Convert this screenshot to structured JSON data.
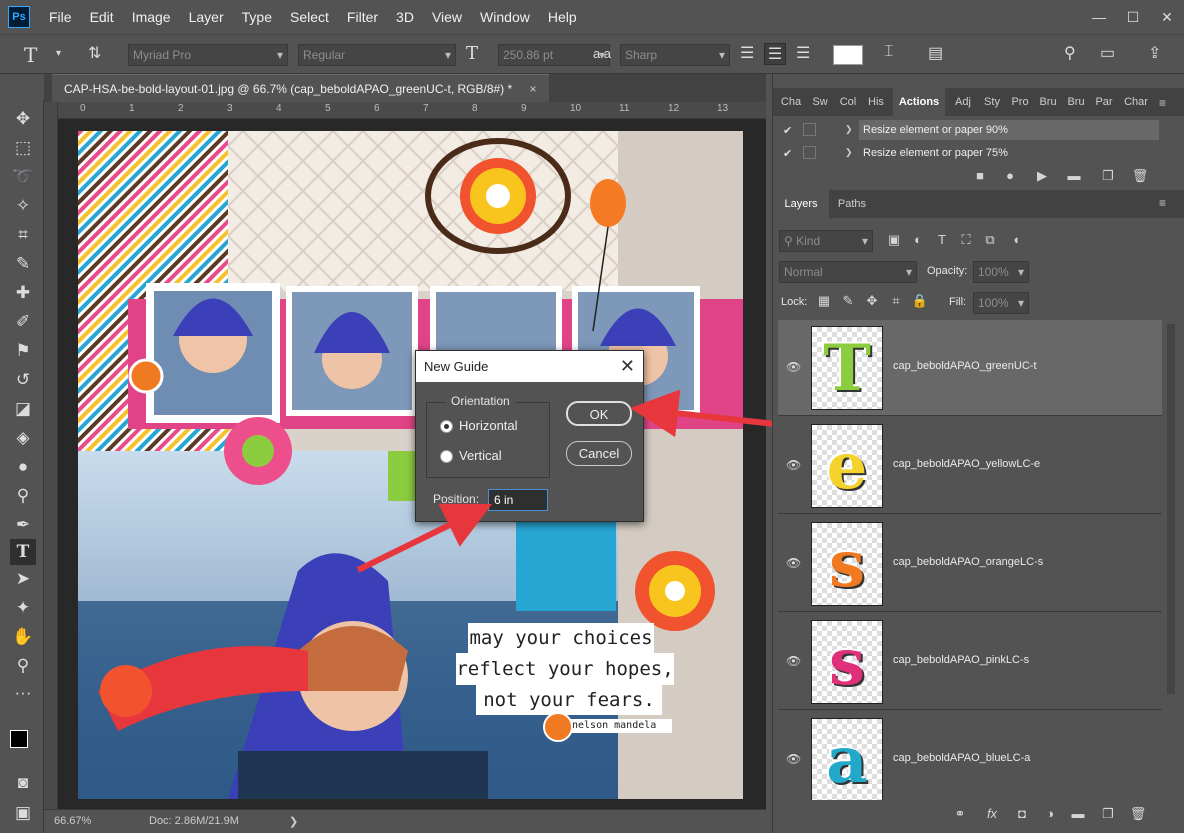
{
  "app": {
    "logo": "Ps"
  },
  "menu": [
    "File",
    "Edit",
    "Image",
    "Layer",
    "Type",
    "Select",
    "Filter",
    "3D",
    "View",
    "Window",
    "Help"
  ],
  "window_controls": {
    "minimize": "—",
    "maximize": "☐",
    "close": "✕"
  },
  "options": {
    "font_family": "Myriad Pro",
    "font_style": "Regular",
    "font_size": "250.86 pt",
    "aa_label": "a a",
    "antialias": "Sharp"
  },
  "document": {
    "tab_title": "CAP-HSA-be-bold-layout-01.jpg @ 66.7% (cap_beboldAPAO_greenUC-t, RGB/8#) *",
    "tab_close": "×",
    "ruler_numbers": [
      "0",
      "1",
      "2",
      "3",
      "4",
      "5",
      "6",
      "7",
      "8",
      "9",
      "10",
      "11",
      "12",
      "13"
    ]
  },
  "artwork": {
    "quote_lines": [
      "may your choices",
      "reflect your hopes,",
      "not your fears."
    ],
    "attribution": "nelson mandela"
  },
  "status": {
    "zoom": "66.67%",
    "doc": "Doc: 2.86M/21.9M",
    "arrow": "❯"
  },
  "dialog": {
    "title": "New Guide",
    "close": "✕",
    "group_label": "Orientation",
    "horizontal_label": "Horizontal",
    "vertical_label": "Vertical",
    "selected_orientation": "Horizontal",
    "ok_label": "OK",
    "cancel_label": "Cancel",
    "position_label": "Position:",
    "position_value": "6 in"
  },
  "panels": {
    "top_tabs": [
      "Cha",
      "Sw",
      "Col",
      "His",
      "Actions",
      "Adj",
      "Sty",
      "Pro",
      "Bru",
      "Bru",
      "Par",
      "Char"
    ],
    "active_top_tab": "Actions",
    "actions": [
      "Resize element or paper 90%",
      "Resize element or paper 75%"
    ],
    "action_expand": "❯",
    "check": "✔",
    "layer_tabs": [
      "Layers",
      "Paths"
    ],
    "kind_label": "Kind",
    "blend_mode": "Normal",
    "opacity_label": "Opacity:",
    "opacity_value": "100%",
    "lock_label": "Lock:",
    "fill_label": "Fill:",
    "fill_value": "100%",
    "layers": [
      {
        "name": "cap_beboldAPAO_greenUC-t",
        "letter": "T",
        "color": "#8ccc3f",
        "selected": true
      },
      {
        "name": "cap_beboldAPAO_yellowLC-e",
        "letter": "e",
        "color": "#f2d22b",
        "selected": false
      },
      {
        "name": "cap_beboldAPAO_orangeLC-s",
        "letter": "s",
        "color": "#f07a22",
        "selected": false
      },
      {
        "name": "cap_beboldAPAO_pinkLC-s",
        "letter": "s",
        "color": "#e0307a",
        "selected": false
      },
      {
        "name": "cap_beboldAPAO_blueLC-a",
        "letter": "a",
        "color": "#22a9c9",
        "selected": false
      }
    ]
  },
  "colors": {
    "accent_arrow": "#e8373c",
    "ps_blue": "#31a8ff"
  }
}
